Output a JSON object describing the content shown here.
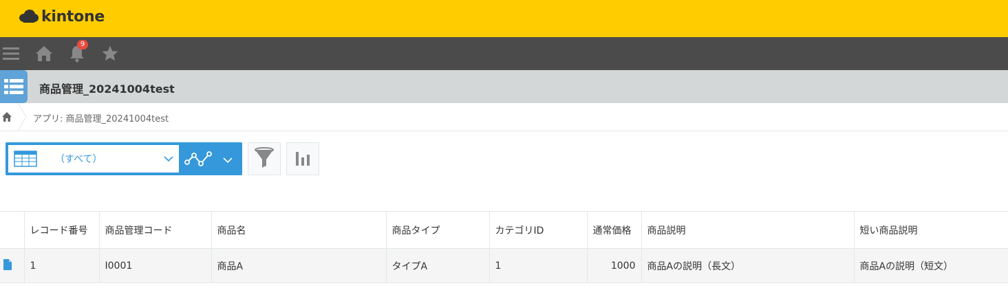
{
  "brand": {
    "name": "kintone",
    "color": "#ffcc00"
  },
  "nav": {
    "icons": [
      "menu-icon",
      "home-icon",
      "bell-icon",
      "star-icon"
    ],
    "notification_count": "9"
  },
  "app": {
    "title": "商品管理_20241004test",
    "accent": "#3498db"
  },
  "breadcrumb": {
    "text": "アプリ: 商品管理_20241004test"
  },
  "toolbar": {
    "view_label": "（すべて）"
  },
  "table": {
    "headers": [
      "",
      "レコード番号",
      "商品管理コード",
      "商品名",
      "商品タイプ",
      "カテゴリID",
      "通常価格",
      "商品説明",
      "短い商品説明"
    ],
    "rows": [
      [
        "",
        "1",
        "I0001",
        "商品A",
        "タイプA",
        "1",
        "1000",
        "商品Aの説明（長文）",
        "商品Aの説明（短文）"
      ]
    ]
  }
}
